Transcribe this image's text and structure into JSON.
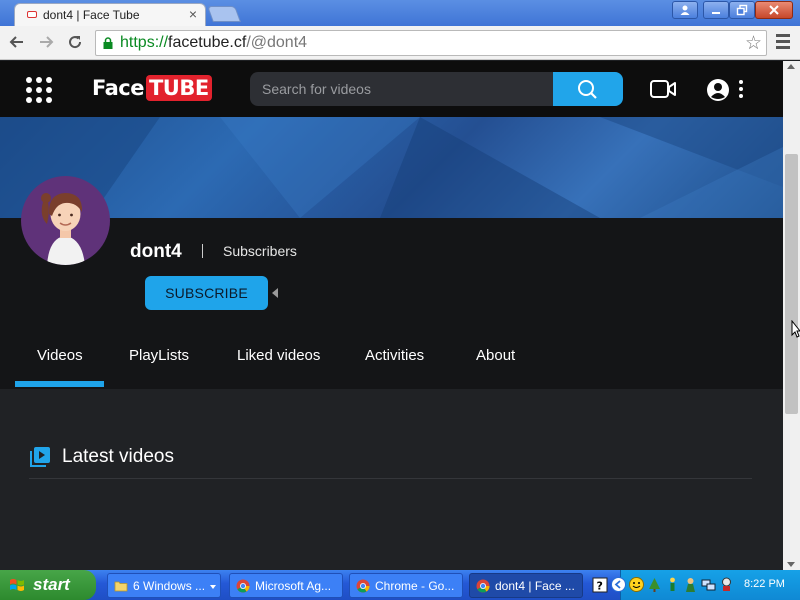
{
  "browser": {
    "tab_title": "dont4 | Face Tube",
    "tab_close": "×",
    "url_scheme": "https://",
    "url_host": "facetube.cf",
    "url_path": "/@dont4",
    "window_buttons": [
      "user-icon",
      "minimize-icon",
      "restore-icon",
      "close-icon"
    ]
  },
  "site": {
    "logo_face": "Face",
    "logo_tube": "TUBE",
    "search_placeholder": "Search for videos",
    "accent_color": "#21a5ea"
  },
  "channel": {
    "name": "dont4",
    "divider": "|",
    "subscribers_label": "Subscribers",
    "subscribe_label": "SUBSCRIBE"
  },
  "tabs": [
    {
      "label": "Videos",
      "active": true
    },
    {
      "label": "PlayLists"
    },
    {
      "label": "Liked videos"
    },
    {
      "label": "Activities"
    },
    {
      "label": "About"
    }
  ],
  "content": {
    "section_title": "Latest videos"
  },
  "taskbar": {
    "start_label": "start",
    "buttons": [
      {
        "label": "6 Windows ...",
        "icon": "folder-icon"
      },
      {
        "label": "Microsoft Ag...",
        "icon": "chrome-icon"
      },
      {
        "label": "Chrome - Go...",
        "icon": "chrome-icon"
      },
      {
        "label": "dont4 | Face ...",
        "icon": "chrome-icon",
        "active": true
      }
    ],
    "clock": "8:22 PM"
  }
}
